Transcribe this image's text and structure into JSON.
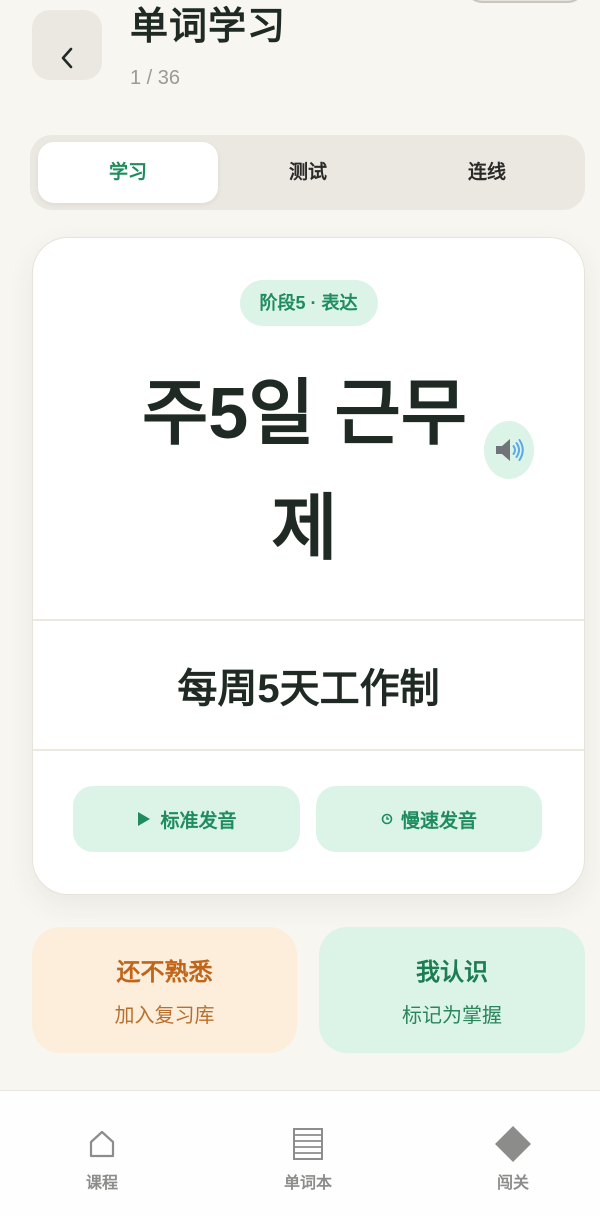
{
  "header": {
    "back_icon": "chevron-left-icon",
    "title": "单词学习",
    "progress": "1 / 36"
  },
  "tabs": [
    {
      "label": "学习",
      "active": true
    },
    {
      "label": "测试",
      "active": false
    },
    {
      "label": "连线",
      "active": false
    }
  ],
  "card": {
    "badge": "阶段5 · 表达",
    "word": "주5일 근무제",
    "speaker_icon": "speaker-icon",
    "meaning": "每周5天工作制",
    "audio_buttons": [
      {
        "icon": "play-icon",
        "label": "标准发音"
      },
      {
        "icon": "clock-icon",
        "label": "慢速发音"
      }
    ]
  },
  "actions": [
    {
      "title": "还不熟悉",
      "subtitle": "加入复习库"
    },
    {
      "title": "我认识",
      "subtitle": "标记为掌握"
    }
  ],
  "nav": [
    {
      "icon": "home-icon",
      "label": "课程"
    },
    {
      "icon": "notebook-icon",
      "label": "单词本"
    },
    {
      "icon": "diamond-icon",
      "label": "闯关"
    }
  ],
  "colors": {
    "background": "#f8f6f1",
    "accent_green": "#1e8c5e",
    "light_green": "#dcf3e8",
    "peach": "#fdeedc",
    "orange_text": "#c0661c",
    "dark_text": "#1f2a25",
    "nav_gray": "#8c8c8a"
  }
}
